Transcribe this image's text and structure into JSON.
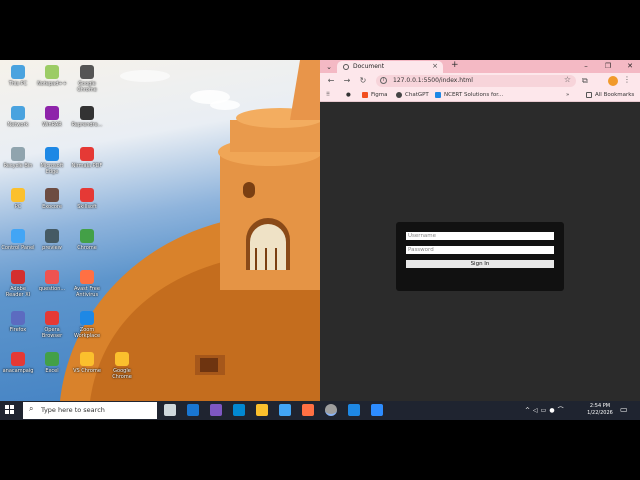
{
  "desktop": {
    "icons": [
      {
        "label": "This PC",
        "color": "#4aa3df",
        "col": 0,
        "row": 0
      },
      {
        "label": "Notepad++",
        "color": "#9ccc65",
        "col": 1,
        "row": 0
      },
      {
        "label": "Google Chrome",
        "color": "#555555",
        "col": 2,
        "row": 0
      },
      {
        "label": "Network",
        "color": "#4aa3df",
        "col": 0,
        "row": 1
      },
      {
        "label": "WinRAR",
        "color": "#8e24aa",
        "col": 1,
        "row": 1
      },
      {
        "label": "Reprendre...",
        "color": "#333333",
        "col": 2,
        "row": 1
      },
      {
        "label": "Recycle Bin",
        "color": "#90a4ae",
        "col": 0,
        "row": 2
      },
      {
        "label": "Microsoft Edge",
        "color": "#1e88e5",
        "col": 1,
        "row": 2
      },
      {
        "label": "Nirmala PDF",
        "color": "#e53935",
        "col": 2,
        "row": 2
      },
      {
        "label": "PC",
        "color": "#fbc02d",
        "col": 0,
        "row": 3
      },
      {
        "label": "Exocore",
        "color": "#6d4c41",
        "col": 1,
        "row": 3
      },
      {
        "label": "Skillsoft",
        "color": "#e53935",
        "col": 2,
        "row": 3
      },
      {
        "label": "Control Panel",
        "color": "#42a5f5",
        "col": 0,
        "row": 4
      },
      {
        "label": "preview",
        "color": "#455a64",
        "col": 1,
        "row": 4
      },
      {
        "label": "Chrome",
        "color": "#43a047",
        "col": 2,
        "row": 4
      },
      {
        "label": "Adobe Reader XI",
        "color": "#d32f2f",
        "col": 0,
        "row": 5
      },
      {
        "label": "question...",
        "color": "#ef5350",
        "col": 1,
        "row": 5
      },
      {
        "label": "Avast Free Antivirus",
        "color": "#ff7043",
        "col": 2,
        "row": 5
      },
      {
        "label": "Firefox",
        "color": "#5c6bc0",
        "col": 0,
        "row": 6
      },
      {
        "label": "Opera Browser",
        "color": "#e53935",
        "col": 1,
        "row": 6
      },
      {
        "label": "Zoom Workplace",
        "color": "#1e88e5",
        "col": 2,
        "row": 6
      },
      {
        "label": "anacampaig",
        "color": "#e53935",
        "col": 0,
        "row": 7
      },
      {
        "label": "Excel",
        "color": "#43a047",
        "col": 1,
        "row": 7
      },
      {
        "label": "VS Chrome",
        "color": "#fbc02d",
        "col": 2,
        "row": 7
      },
      {
        "label": "Google Chrome",
        "color": "#fbc02d",
        "col": 3,
        "row": 7
      }
    ]
  },
  "browser": {
    "tab_title": "Document",
    "url": "127.0.0.1:5500/index.html",
    "bookmarks": [
      {
        "label": "Figma",
        "color": "#f24e1e"
      },
      {
        "label": "ChatGPT",
        "color": "#444444"
      },
      {
        "label": "NCERT Solutions for...",
        "color": "#1e88e5"
      }
    ],
    "all_bookmarks": "All Bookmarks",
    "login": {
      "username_placeholder": "Username",
      "password_placeholder": "Password",
      "signin_label": "Sign In"
    }
  },
  "taskbar": {
    "search_placeholder": "Type here to search",
    "time": "2:54 PM",
    "date": "1/22/2026",
    "apps": [
      {
        "name": "task-view",
        "color": "#cfd8dc"
      },
      {
        "name": "outlook",
        "color": "#1976d2"
      },
      {
        "name": "copilot",
        "color": "#7e57c2"
      },
      {
        "name": "edge",
        "color": "#0288d1"
      },
      {
        "name": "file-explorer",
        "color": "#fbc02d"
      },
      {
        "name": "store",
        "color": "#42a5f5"
      },
      {
        "name": "firefox",
        "color": "#ff7043"
      },
      {
        "name": "chrome",
        "color": "#9e9e9e"
      },
      {
        "name": "vscode",
        "color": "#1e88e5"
      },
      {
        "name": "zoom",
        "color": "#2d8cff"
      }
    ]
  },
  "colors": {
    "tab_bar": "#f4b9c4",
    "toolbar": "#fde7eb",
    "page_bg": "#2b2b2b",
    "login_box": "#111111"
  }
}
